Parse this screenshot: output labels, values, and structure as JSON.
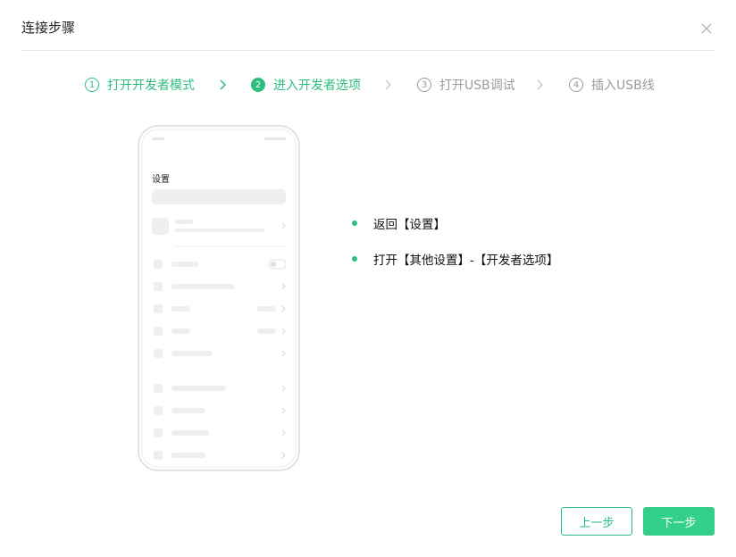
{
  "dialog": {
    "title": "连接步骤"
  },
  "steps": [
    {
      "num": "1",
      "label": "打开开发者模式",
      "state": "done"
    },
    {
      "num": "2",
      "label": "进入开发者选项",
      "state": "active"
    },
    {
      "num": "3",
      "label": "打开USB调试",
      "state": "pending"
    },
    {
      "num": "4",
      "label": "插入USB线",
      "state": "pending"
    }
  ],
  "phone": {
    "screen_title": "设置"
  },
  "instructions": [
    "返回【设置】",
    "打开【其他设置】-【开发者选项】"
  ],
  "buttons": {
    "prev_label": "上一步",
    "next_label": "下一步"
  },
  "colors": {
    "accent": "#2dbd7f",
    "pending": "#9b9b9b"
  }
}
